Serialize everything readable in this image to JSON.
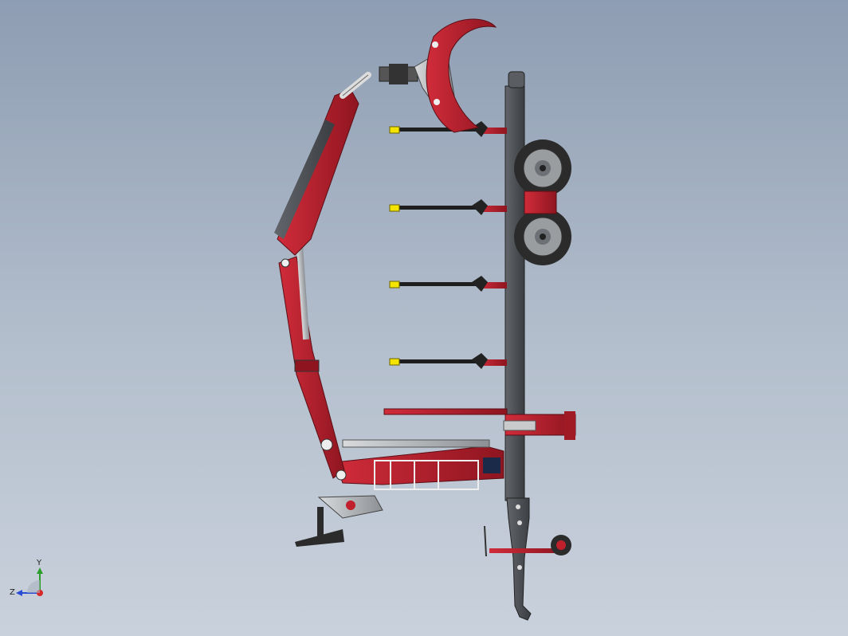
{
  "triad": {
    "y_label": "Y",
    "z_label": "Z",
    "colors": {
      "y": "#2a9d2a",
      "z": "#2a4bd6",
      "x": "#d62828"
    }
  },
  "colors": {
    "boom_red": "#b01e2b",
    "frame_dark": "#4a4d52",
    "stake_yellow": "#f5e400",
    "grapple_grey": "#b9b9b9",
    "tire_dark": "#2b2b2b",
    "cylinder_grey": "#9ea3a8"
  }
}
